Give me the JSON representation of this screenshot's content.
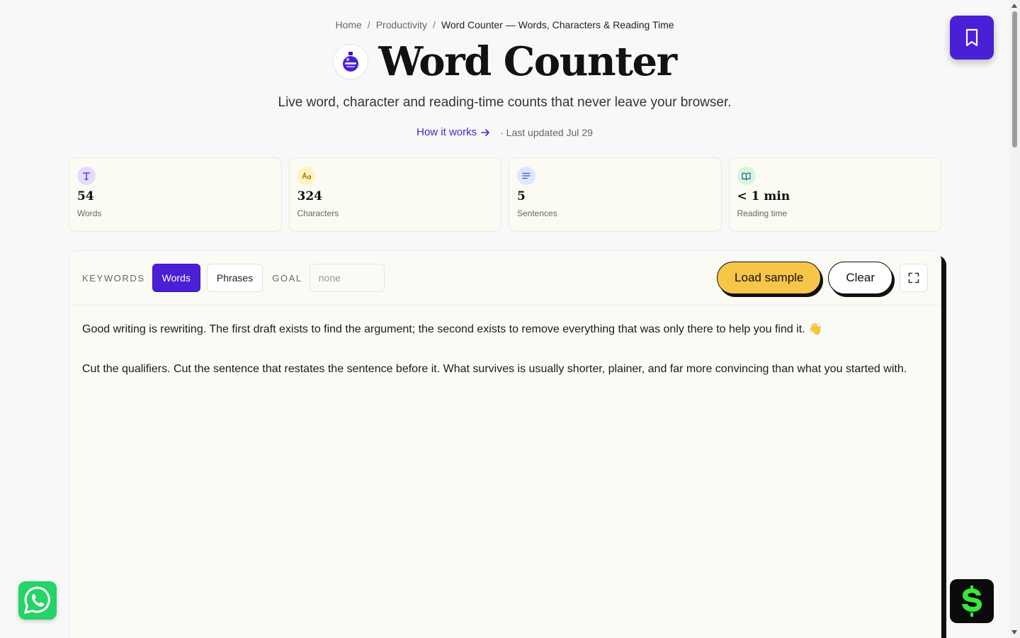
{
  "breadcrumb": {
    "home": "Home",
    "separator": "/",
    "category": "Productivity",
    "current": "Word Counter — Words, Characters & Reading Time"
  },
  "header": {
    "title": "Word Counter",
    "logo_icon": "potion-flask-icon",
    "subtitle": "Live word, character and reading-time counts that never leave your browser.",
    "how_link": "How it works",
    "updated": "· Last updated Jul 29"
  },
  "stats": [
    {
      "icon": "text-type-icon",
      "glyph": "T",
      "value": "54",
      "label": "Words",
      "color": "#e4dcff",
      "fg": "#4a1fd6"
    },
    {
      "icon": "font-aa-icon",
      "glyph": "Aa",
      "value": "324",
      "label": "Characters",
      "color": "#fff3c4",
      "fg": "#a8660a"
    },
    {
      "icon": "align-lines-icon",
      "glyph": "≡",
      "value": "5",
      "label": "Sentences",
      "color": "#dfe6ff",
      "fg": "#3a4fc4"
    },
    {
      "icon": "book-open-icon",
      "glyph": "📖",
      "value": "< 1 min",
      "label": "Reading time",
      "color": "#d9f6dd",
      "fg": "#1e7a3a"
    }
  ],
  "toolbar": {
    "keywords_label": "KEYWORDS",
    "words_btn": "Words",
    "phrases_btn": "Phrases",
    "goal_label": "GOAL",
    "goal_placeholder": "none",
    "load_btn": "Load sample",
    "clear_btn": "Clear"
  },
  "editor": {
    "paragraphs": [
      "Good writing is rewriting. The first draft exists to find the argument; the second exists to remove everything that was only there to help you find it. 👋",
      "Cut the qualifiers. Cut the sentence that restates the sentence before it. What survives is usually shorter, plainer, and far more convincing than what you started with."
    ]
  },
  "colors": {
    "accent": "#4a1fd6",
    "sample_button": "#f7c548",
    "whatsapp": "#25d366",
    "brand_green": "#39e639"
  }
}
